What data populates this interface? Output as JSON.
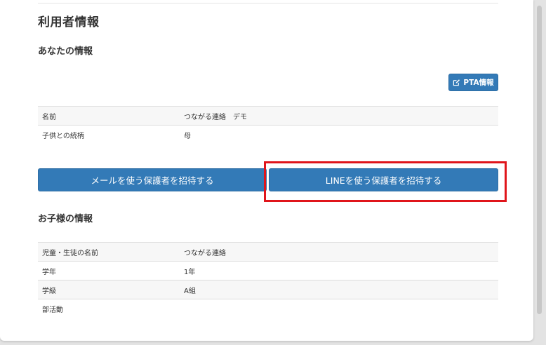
{
  "page": {
    "title": "利用者情報"
  },
  "your_info": {
    "heading": "あなたの情報",
    "pta_button_label": "PTA情報",
    "pta_button_icon": "edit-icon",
    "rows": [
      {
        "label": "名前",
        "value": "つながる連絡　デモ"
      },
      {
        "label": "子供との続柄",
        "value": "母"
      }
    ]
  },
  "invite": {
    "email_button_label": "メールを使う保護者を招待する",
    "line_button_label": "LINEを使う保護者を招待する",
    "highlight_color": "#e0151b"
  },
  "children_info": {
    "heading": "お子様の情報",
    "rows": [
      {
        "label": "児童・生徒の名前",
        "value": "つながる連絡"
      },
      {
        "label": "学年",
        "value": "1年"
      },
      {
        "label": "学級",
        "value": "A組"
      },
      {
        "label": "部活動",
        "value": ""
      }
    ]
  },
  "colors": {
    "primary_button": "#337ab7",
    "table_stripe": "#f7f7f7",
    "table_border": "#dddddd"
  }
}
